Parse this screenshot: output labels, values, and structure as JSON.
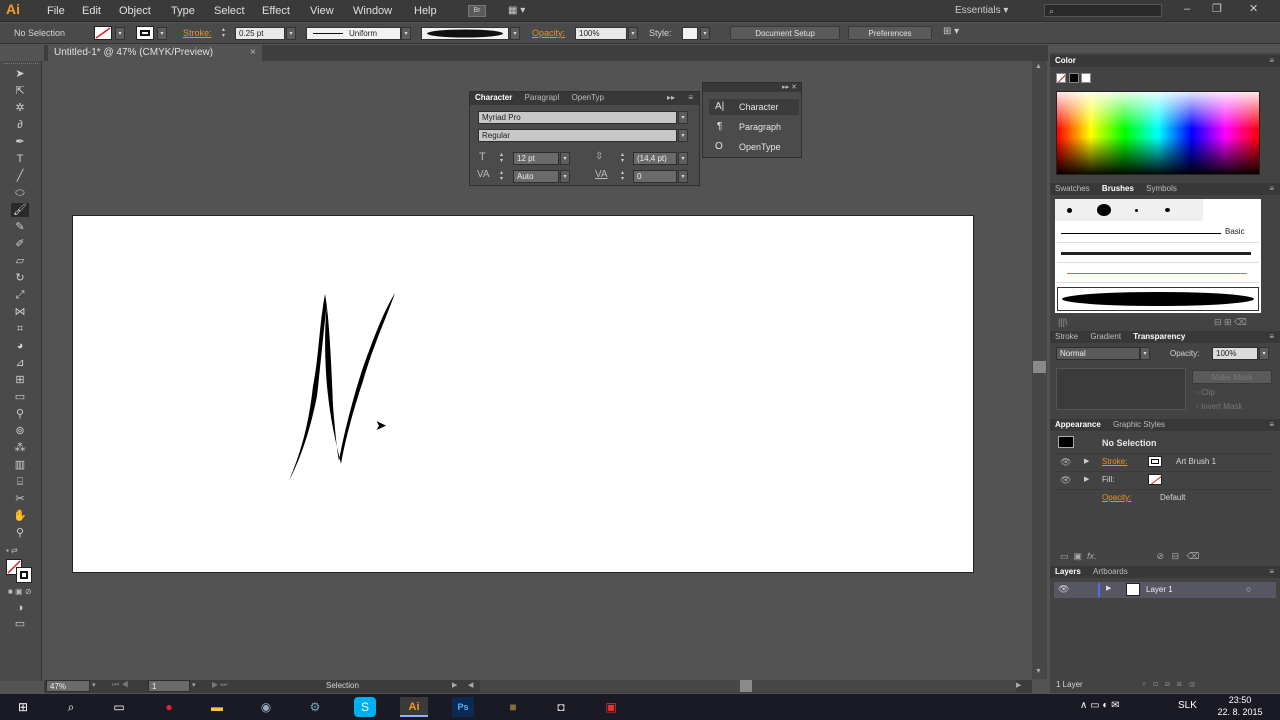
{
  "app": {
    "logo": "Ai"
  },
  "menu": [
    "File",
    "Edit",
    "Object",
    "Type",
    "Select",
    "Effect",
    "View",
    "Window",
    "Help"
  ],
  "workspace": {
    "label": "Essentials"
  },
  "control": {
    "selection": "No Selection",
    "stroke_label": "Stroke:",
    "stroke_value": "0.25 pt",
    "profile": "Uniform",
    "opacity_label": "Opacity:",
    "opacity_value": "100%",
    "style_label": "Style:",
    "doc_setup": "Document Setup",
    "preferences": "Preferences"
  },
  "doc_tab": {
    "title": "Untitled-1* @ 47% (CMYK/Preview)"
  },
  "character_panel": {
    "tabs": [
      "Character",
      "Paragrapl",
      "OpenTyp"
    ],
    "font": "Myriad Pro",
    "style": "Regular",
    "size": "12 pt",
    "leading": "(14,4 pt)",
    "kerning": "Auto",
    "tracking": "0"
  },
  "flyout": {
    "items": [
      "Character",
      "Paragraph",
      "OpenType"
    ]
  },
  "color_panel": {
    "title": "Color"
  },
  "swatch_tabs": [
    "Swatches",
    "Brushes",
    "Symbols"
  ],
  "brushes": {
    "basic_label": "Basic"
  },
  "transparency": {
    "tabs": [
      "Stroke",
      "Gradient",
      "Transparency"
    ],
    "mode": "Normal",
    "opacity_label": "Opacity:",
    "opacity": "100%",
    "make_mask": "Make Mask",
    "clip": "Clip",
    "invert": "Invert Mask"
  },
  "appearance": {
    "tabs": [
      "Appearance",
      "Graphic Styles"
    ],
    "title": "No Selection",
    "stroke_label": "Stroke:",
    "stroke_value": "Art Brush 1",
    "fill_label": "Fill:",
    "opacity_label": "Opacity:",
    "opacity_value": "Default"
  },
  "layers": {
    "tabs": [
      "Layers",
      "Artboards"
    ],
    "layer_name": "Layer 1",
    "footer": "1 Layer"
  },
  "status": {
    "zoom": "47%",
    "page": "1",
    "tool": "Selection"
  },
  "taskbar": {
    "lang": "SLK",
    "time": "23:50",
    "date": "22. 8. 2015"
  }
}
